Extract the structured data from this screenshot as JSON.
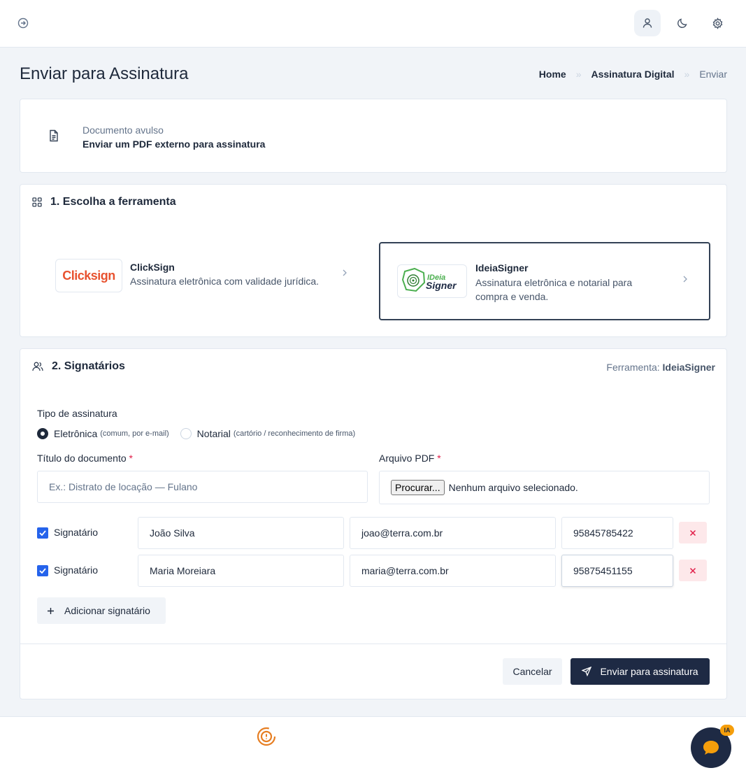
{
  "header": {
    "title": "Enviar para Assinatura",
    "breadcrumb": [
      "Home",
      "Assinatura Digital",
      "Enviar"
    ],
    "breadcrumb_separator": "»"
  },
  "document": {
    "subtitle": "Documento avulso",
    "title": "Enviar um PDF externo para assinatura"
  },
  "tools_section": {
    "heading": "1. Escolha a ferramenta",
    "tools": [
      {
        "name": "ClickSign",
        "logo_text": "Clicksign",
        "description": "Assinatura eletrônica com validade jurídica.",
        "selected": false
      },
      {
        "name": "IdeiaSigner",
        "logo_text_top": "IDeia",
        "logo_text_bottom": "Signer",
        "description": "Assinatura eletrônica e notarial para compra e venda.",
        "selected": true
      }
    ]
  },
  "signers_section": {
    "heading": "2. Signatários",
    "tool_indicator_label": "Ferramenta:",
    "tool_indicator_value": "IdeiaSigner",
    "signature_type_label": "Tipo de assinatura",
    "signature_types": [
      {
        "label": "Eletrônica",
        "hint": "(comum, por e-mail)",
        "checked": true
      },
      {
        "label": "Notarial",
        "hint": "(cartório / reconhecimento de firma)",
        "checked": false
      }
    ],
    "doc_title_label": "Título do documento",
    "doc_title_placeholder": "Ex.: Distrato de locação — Fulano",
    "pdf_label": "Arquivo PDF",
    "required_mark": "*",
    "file_button": "Procurar...",
    "file_status": "Nenhum arquivo selecionado.",
    "signer_label": "Signatário",
    "signers": [
      {
        "name": "João Silva",
        "email": "joao@terra.com.br",
        "phone": "95845785422"
      },
      {
        "name": "Maria Moreiara",
        "email": "maria@terra.com.br",
        "phone": "95875451155"
      }
    ],
    "add_signer_label": "Adicionar signatário",
    "cancel_label": "Cancelar",
    "send_label": "Enviar para assinatura"
  },
  "chat": {
    "badge": "IA"
  },
  "colors": {
    "primary": "#1e2a44",
    "danger": "#e11d48",
    "checkbox": "#2563eb",
    "clicksign": "#e8522f",
    "badge": "#f59e0b"
  }
}
